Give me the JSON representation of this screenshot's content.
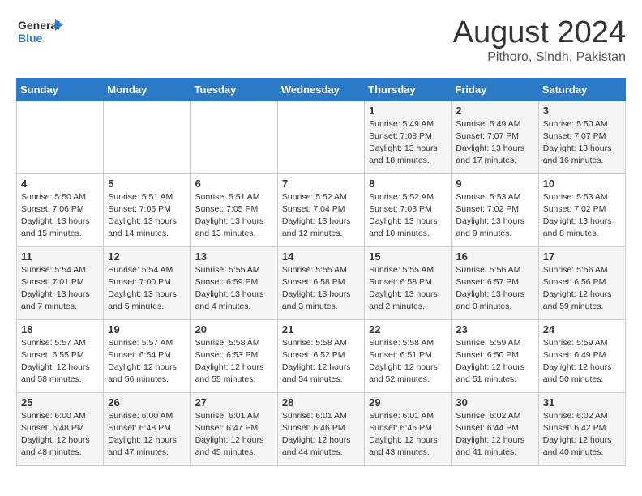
{
  "header": {
    "logo_line1": "General",
    "logo_line2": "Blue",
    "month": "August 2024",
    "location": "Pithoro, Sindh, Pakistan"
  },
  "weekdays": [
    "Sunday",
    "Monday",
    "Tuesday",
    "Wednesday",
    "Thursday",
    "Friday",
    "Saturday"
  ],
  "weeks": [
    [
      {
        "day": "",
        "info": ""
      },
      {
        "day": "",
        "info": ""
      },
      {
        "day": "",
        "info": ""
      },
      {
        "day": "",
        "info": ""
      },
      {
        "day": "1",
        "info": "Sunrise: 5:49 AM\nSunset: 7:08 PM\nDaylight: 13 hours\nand 18 minutes."
      },
      {
        "day": "2",
        "info": "Sunrise: 5:49 AM\nSunset: 7:07 PM\nDaylight: 13 hours\nand 17 minutes."
      },
      {
        "day": "3",
        "info": "Sunrise: 5:50 AM\nSunset: 7:07 PM\nDaylight: 13 hours\nand 16 minutes."
      }
    ],
    [
      {
        "day": "4",
        "info": "Sunrise: 5:50 AM\nSunset: 7:06 PM\nDaylight: 13 hours\nand 15 minutes."
      },
      {
        "day": "5",
        "info": "Sunrise: 5:51 AM\nSunset: 7:05 PM\nDaylight: 13 hours\nand 14 minutes."
      },
      {
        "day": "6",
        "info": "Sunrise: 5:51 AM\nSunset: 7:05 PM\nDaylight: 13 hours\nand 13 minutes."
      },
      {
        "day": "7",
        "info": "Sunrise: 5:52 AM\nSunset: 7:04 PM\nDaylight: 13 hours\nand 12 minutes."
      },
      {
        "day": "8",
        "info": "Sunrise: 5:52 AM\nSunset: 7:03 PM\nDaylight: 13 hours\nand 10 minutes."
      },
      {
        "day": "9",
        "info": "Sunrise: 5:53 AM\nSunset: 7:02 PM\nDaylight: 13 hours\nand 9 minutes."
      },
      {
        "day": "10",
        "info": "Sunrise: 5:53 AM\nSunset: 7:02 PM\nDaylight: 13 hours\nand 8 minutes."
      }
    ],
    [
      {
        "day": "11",
        "info": "Sunrise: 5:54 AM\nSunset: 7:01 PM\nDaylight: 13 hours\nand 7 minutes."
      },
      {
        "day": "12",
        "info": "Sunrise: 5:54 AM\nSunset: 7:00 PM\nDaylight: 13 hours\nand 5 minutes."
      },
      {
        "day": "13",
        "info": "Sunrise: 5:55 AM\nSunset: 6:59 PM\nDaylight: 13 hours\nand 4 minutes."
      },
      {
        "day": "14",
        "info": "Sunrise: 5:55 AM\nSunset: 6:58 PM\nDaylight: 13 hours\nand 3 minutes."
      },
      {
        "day": "15",
        "info": "Sunrise: 5:55 AM\nSunset: 6:58 PM\nDaylight: 13 hours\nand 2 minutes."
      },
      {
        "day": "16",
        "info": "Sunrise: 5:56 AM\nSunset: 6:57 PM\nDaylight: 13 hours\nand 0 minutes."
      },
      {
        "day": "17",
        "info": "Sunrise: 5:56 AM\nSunset: 6:56 PM\nDaylight: 12 hours\nand 59 minutes."
      }
    ],
    [
      {
        "day": "18",
        "info": "Sunrise: 5:57 AM\nSunset: 6:55 PM\nDaylight: 12 hours\nand 58 minutes."
      },
      {
        "day": "19",
        "info": "Sunrise: 5:57 AM\nSunset: 6:54 PM\nDaylight: 12 hours\nand 56 minutes."
      },
      {
        "day": "20",
        "info": "Sunrise: 5:58 AM\nSunset: 6:53 PM\nDaylight: 12 hours\nand 55 minutes."
      },
      {
        "day": "21",
        "info": "Sunrise: 5:58 AM\nSunset: 6:52 PM\nDaylight: 12 hours\nand 54 minutes."
      },
      {
        "day": "22",
        "info": "Sunrise: 5:58 AM\nSunset: 6:51 PM\nDaylight: 12 hours\nand 52 minutes."
      },
      {
        "day": "23",
        "info": "Sunrise: 5:59 AM\nSunset: 6:50 PM\nDaylight: 12 hours\nand 51 minutes."
      },
      {
        "day": "24",
        "info": "Sunrise: 5:59 AM\nSunset: 6:49 PM\nDaylight: 12 hours\nand 50 minutes."
      }
    ],
    [
      {
        "day": "25",
        "info": "Sunrise: 6:00 AM\nSunset: 6:48 PM\nDaylight: 12 hours\nand 48 minutes."
      },
      {
        "day": "26",
        "info": "Sunrise: 6:00 AM\nSunset: 6:48 PM\nDaylight: 12 hours\nand 47 minutes."
      },
      {
        "day": "27",
        "info": "Sunrise: 6:01 AM\nSunset: 6:47 PM\nDaylight: 12 hours\nand 45 minutes."
      },
      {
        "day": "28",
        "info": "Sunrise: 6:01 AM\nSunset: 6:46 PM\nDaylight: 12 hours\nand 44 minutes."
      },
      {
        "day": "29",
        "info": "Sunrise: 6:01 AM\nSunset: 6:45 PM\nDaylight: 12 hours\nand 43 minutes."
      },
      {
        "day": "30",
        "info": "Sunrise: 6:02 AM\nSunset: 6:44 PM\nDaylight: 12 hours\nand 41 minutes."
      },
      {
        "day": "31",
        "info": "Sunrise: 6:02 AM\nSunset: 6:42 PM\nDaylight: 12 hours\nand 40 minutes."
      }
    ]
  ]
}
